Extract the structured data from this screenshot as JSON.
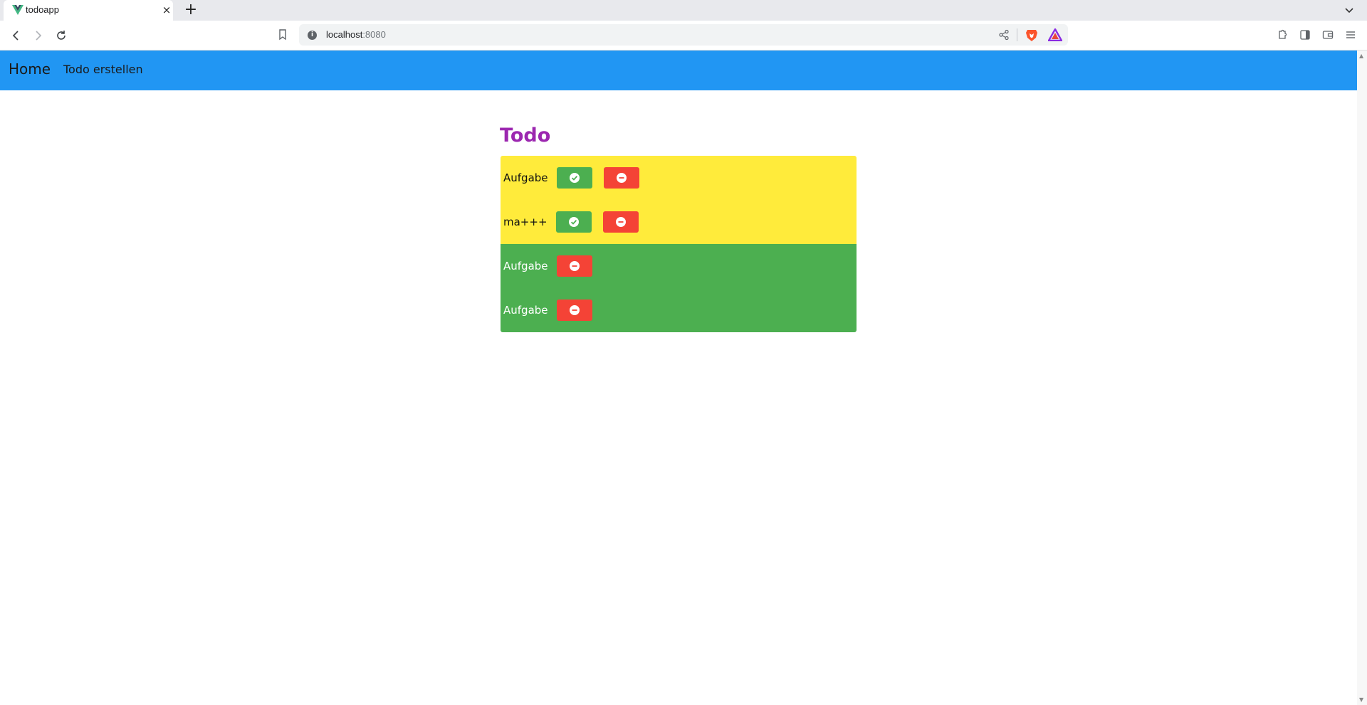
{
  "browser": {
    "tab_title": "todoapp",
    "tab_close": "×",
    "new_tab": "+",
    "url_host": "localhost",
    "url_port": ":8080",
    "url_info": "i"
  },
  "nav": {
    "home": "Home",
    "create_todo": "Todo erstellen"
  },
  "main": {
    "heading": "Todo",
    "todos": [
      {
        "text": "Aufgabe",
        "status": "open"
      },
      {
        "text": "ma+++",
        "status": "open"
      },
      {
        "text": "Aufgabe",
        "status": "done"
      },
      {
        "text": "Aufgabe",
        "status": "done"
      }
    ]
  },
  "colors": {
    "navbar": "#2196f3",
    "heading": "#9c27b0",
    "open_item": "#ffeb3b",
    "done_item": "#4caf50",
    "done_button": "#4caf50",
    "delete_button": "#f44336"
  },
  "icons": {
    "done_button": "check-circle-icon",
    "delete_button": "minus-circle-icon"
  }
}
